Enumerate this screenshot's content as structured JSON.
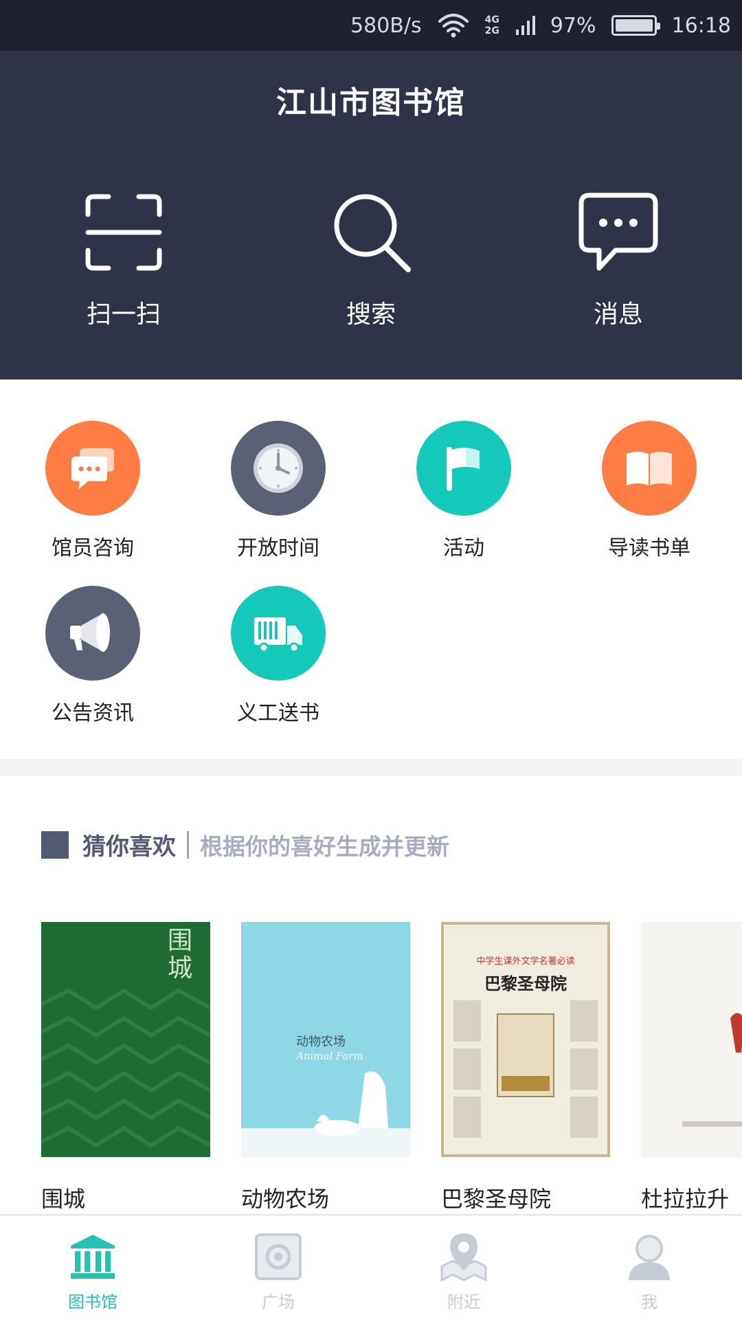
{
  "status_bar": {
    "speed": "580B/s",
    "network_top": "4G",
    "network_bottom": "2G",
    "battery": "97%",
    "time": "16:18"
  },
  "header": {
    "title": "江山市图书馆"
  },
  "quick_actions": [
    {
      "label": "扫一扫",
      "icon": "scan-icon"
    },
    {
      "label": "搜索",
      "icon": "search-icon"
    },
    {
      "label": "消息",
      "icon": "message-icon"
    }
  ],
  "features": [
    {
      "label": "馆员咨询",
      "icon": "chat-bubbles-icon",
      "color": "#ff7d45"
    },
    {
      "label": "开放时间",
      "icon": "clock-icon",
      "color": "#5b6174"
    },
    {
      "label": "活动",
      "icon": "flag-icon",
      "color": "#14c9b9"
    },
    {
      "label": "导读书单",
      "icon": "book-icon",
      "color": "#ff7d45"
    },
    {
      "label": "公告资讯",
      "icon": "megaphone-icon",
      "color": "#5b6174"
    },
    {
      "label": "义工送书",
      "icon": "truck-icon",
      "color": "#14c9b9"
    }
  ],
  "recommend": {
    "title": "猜你喜欢",
    "subtitle": "根据你的喜好生成并更新",
    "books": [
      {
        "title": "围城",
        "cover_text": "围城"
      },
      {
        "title": "动物农场",
        "cover_text": "动物农场",
        "cover_subtext": "Animal Farm"
      },
      {
        "title": "巴黎圣母院",
        "cover_text": "巴黎圣母院",
        "cover_header": "中学生课外文学名著必读"
      },
      {
        "title": "杜拉拉升"
      }
    ]
  },
  "bottom_nav": [
    {
      "label": "图书馆",
      "icon": "library-icon",
      "active": true
    },
    {
      "label": "广场",
      "icon": "square-icon",
      "active": false
    },
    {
      "label": "附近",
      "icon": "nearby-map-icon",
      "active": false
    },
    {
      "label": "我",
      "icon": "user-icon",
      "active": false
    }
  ],
  "colors": {
    "dark_bg": "#2e3347",
    "status_bg": "#1e2130",
    "active_nav": "#22c3b2",
    "inactive_nav": "#c5ccd6",
    "accent_orange": "#ff7d45",
    "accent_teal": "#14c9b9",
    "accent_gray": "#5b6174"
  }
}
